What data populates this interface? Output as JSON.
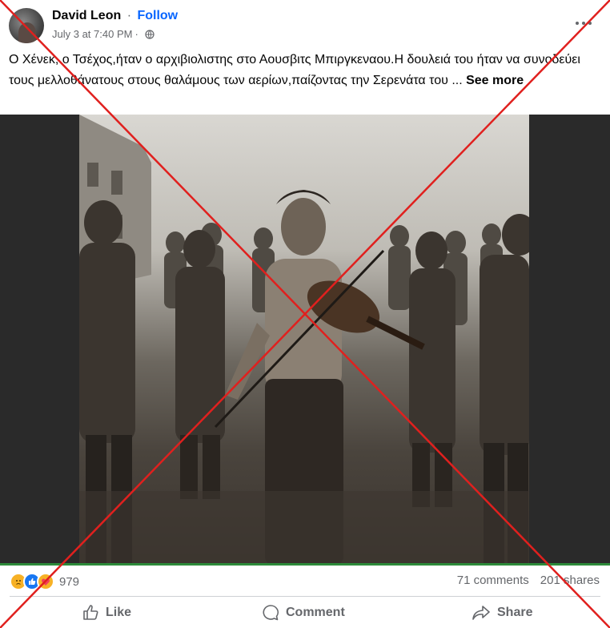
{
  "post": {
    "author": "David Leon",
    "separator": "·",
    "follow_label": "Follow",
    "timestamp": "July 3 at 7:40 PM",
    "meta_separator": "·",
    "text": "Ο Χένεκ, ο Τσέχος,ήταν ο αρχιβιολιστης στο Αουσβιτς Μπιργκεναου.Η δουλειά του ήταν να συνοδεύει τους μελλοθάνατους στους θαλάμους των αερίων,παίζοντας την Σερενάτα του ...",
    "see_more": "See more"
  },
  "icons": {
    "more": "more-options-icon",
    "privacy": "globe-icon",
    "like": "thumbs-up-icon",
    "comment": "comment-bubble-icon",
    "share": "share-arrow-icon"
  },
  "stats": {
    "reaction_count": "979",
    "comments": "71 comments",
    "shares": "201 shares"
  },
  "actions": {
    "like": "Like",
    "comment": "Comment",
    "share": "Share"
  },
  "colors": {
    "follow": "#0866ff",
    "cross_overlay": "#e0201e",
    "secondary_text": "#65676b"
  }
}
